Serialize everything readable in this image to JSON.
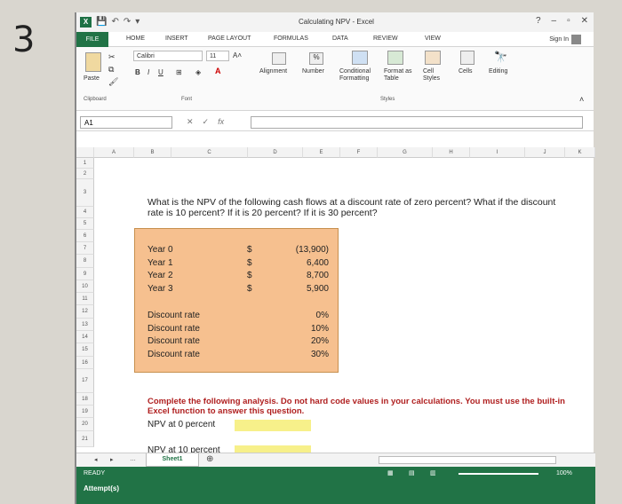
{
  "photo_label": "3",
  "window": {
    "title": "Calculating NPV - Excel",
    "help": "?",
    "controls": [
      "–",
      "▫",
      "✕"
    ]
  },
  "ribbon_tabs": {
    "file": "FILE",
    "items": [
      "HOME",
      "INSERT",
      "PAGE LAYOUT",
      "FORMULAS",
      "DATA",
      "REVIEW",
      "VIEW"
    ],
    "sign_in": "Sign In"
  },
  "ribbon": {
    "paste": "Paste",
    "font_name": "Calibri",
    "font_size": "11",
    "bold": "B",
    "italic": "I",
    "underline": "U",
    "alignment": "Alignment",
    "number": "Number",
    "percent": "%",
    "conditional_formatting": "Conditional Formatting",
    "format_as_table": "Format as Table",
    "cell_styles": "Cell Styles",
    "cells": "Cells",
    "editing": "Editing",
    "groups": {
      "clipboard": "Clipboard",
      "font": "Font",
      "styles": "Styles"
    }
  },
  "formula_bar": {
    "name_box": "A1",
    "fx": "fx",
    "value": ""
  },
  "columns": [
    "A",
    "B",
    "C",
    "D",
    "E",
    "F",
    "G",
    "H",
    "I",
    "J",
    "K"
  ],
  "rows": [
    "1",
    "2",
    "3",
    "4",
    "5",
    "6",
    "7",
    "8",
    "9",
    "10",
    "11",
    "12",
    "13",
    "14",
    "15",
    "16",
    "17",
    "18",
    "19",
    "20",
    "21"
  ],
  "question": "What is the NPV of the following cash flows at a discount rate of zero percent? What if the discount rate is 10 percent? If it is 20 percent? If it is 30 percent?",
  "cash_flows": [
    {
      "label": "Year 0",
      "currency": "$",
      "value": "(13,900)"
    },
    {
      "label": "Year 1",
      "currency": "$",
      "value": "6,400"
    },
    {
      "label": "Year 2",
      "currency": "$",
      "value": "8,700"
    },
    {
      "label": "Year 3",
      "currency": "$",
      "value": "5,900"
    }
  ],
  "discount_rates": [
    {
      "label": "Discount rate",
      "value": "0%"
    },
    {
      "label": "Discount rate",
      "value": "10%"
    },
    {
      "label": "Discount rate",
      "value": "20%"
    },
    {
      "label": "Discount rate",
      "value": "30%"
    }
  ],
  "instruction": "Complete the following analysis. Do not hard code values in your calculations. You must use the built-in Excel function to answer this question.",
  "npv_rows": [
    {
      "label": "NPV at 0 percent",
      "value": ""
    },
    {
      "label": "NPV at 10 percent",
      "value": ""
    }
  ],
  "sheet_tab": "Sheet1",
  "status": {
    "ready": "READY",
    "zoom": "100%"
  },
  "attempts": "Attempt(s)",
  "colors": {
    "excel_green": "#217346",
    "input_box": "#f6c08f",
    "answer_cell": "#f7f08a",
    "instruction_text": "#b02020"
  }
}
